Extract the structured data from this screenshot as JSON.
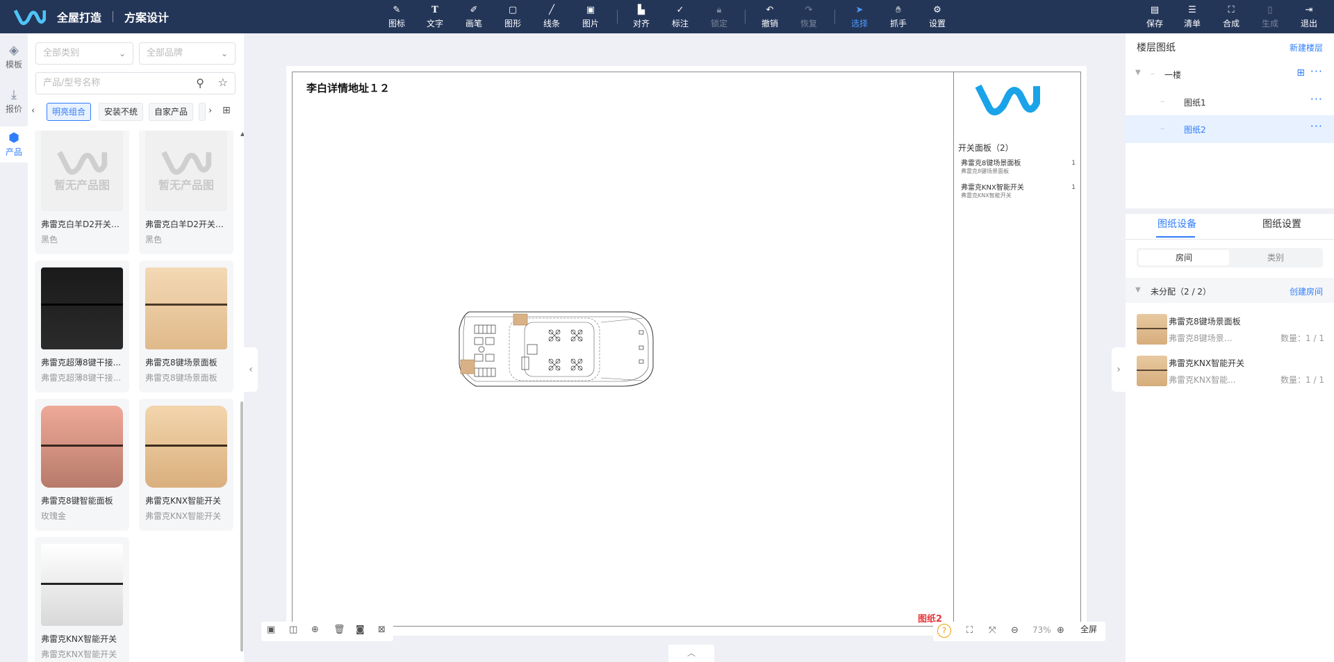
{
  "header": {
    "brand_title": "全屋打造",
    "brand_subtitle": "方案设计"
  },
  "toolbar": {
    "tools": [
      {
        "id": "icon",
        "label": "图标",
        "icon": "shapes-icon"
      },
      {
        "id": "text",
        "label": "文字",
        "icon": "text-icon"
      },
      {
        "id": "pen",
        "label": "画笔",
        "icon": "pen-icon"
      },
      {
        "id": "shape",
        "label": "图形",
        "icon": "rectangle-icon"
      },
      {
        "id": "line",
        "label": "线条",
        "icon": "line-icon"
      },
      {
        "id": "image",
        "label": "图片",
        "icon": "image-icon"
      },
      {
        "id": "align",
        "label": "对齐",
        "icon": "align-icon"
      },
      {
        "id": "mark",
        "label": "标注",
        "icon": "pin-icon"
      },
      {
        "id": "lock",
        "label": "锁定",
        "icon": "lock-icon"
      },
      {
        "id": "undo",
        "label": "撤销",
        "icon": "undo-icon"
      },
      {
        "id": "redo",
        "label": "恢复",
        "icon": "redo-icon"
      },
      {
        "id": "select",
        "label": "选择",
        "icon": "cursor-icon"
      },
      {
        "id": "grab",
        "label": "抓手",
        "icon": "hand-icon"
      },
      {
        "id": "settings",
        "label": "设置",
        "icon": "gear-icon"
      }
    ],
    "actions": [
      {
        "id": "save",
        "label": "保存"
      },
      {
        "id": "list",
        "label": "清单"
      },
      {
        "id": "compose",
        "label": "合成"
      },
      {
        "id": "generate",
        "label": "生成"
      },
      {
        "id": "exit",
        "label": "退出"
      }
    ]
  },
  "leftnav": [
    {
      "label": "模板",
      "icon": "layers-icon"
    },
    {
      "label": "报价",
      "icon": "download-icon"
    },
    {
      "label": "产品",
      "icon": "cube-icon"
    }
  ],
  "filters": {
    "category_placeholder": "全部类别",
    "brand_placeholder": "全部品牌",
    "search_placeholder": "产品/型号名称"
  },
  "tags": [
    "明亮组合",
    "安装不统",
    "自家产品"
  ],
  "products": [
    {
      "name": "弗雷克白羊D2开关分...",
      "sub": "黑色",
      "style": "none",
      "noimg_text": "暂无产品图"
    },
    {
      "name": "弗雷克白羊D2开关分...",
      "sub": "黑色",
      "style": "none",
      "noimg_text": "暂无产品图"
    },
    {
      "name": "弗雷克超薄8键干接...",
      "sub": "弗雷克超薄8键干接...",
      "style": "black"
    },
    {
      "name": "弗雷克8键场景面板",
      "sub": "弗雷克8键场景面板",
      "style": "gold"
    },
    {
      "name": "弗雷克8键智能面板",
      "sub": "玫瑰金",
      "style": "rose"
    },
    {
      "name": "弗雷克KNX智能开关",
      "sub": "弗雷克KNX智能开关",
      "style": "gold"
    },
    {
      "name": "弗雷克KNX智能开关",
      "sub": "弗雷克KNX智能开关",
      "style": "silver"
    }
  ],
  "sheet": {
    "title": "李白详情地址１２",
    "summary_header": "开关面板（2）",
    "items": [
      {
        "name": "弗雷克8键场景面板",
        "sub": "弗雷克8键场景面板",
        "qty": "1"
      },
      {
        "name": "弗雷克KNX智能开关",
        "sub": "弗雷克KNX智能开关",
        "qty": "1"
      }
    ],
    "label": "图纸2"
  },
  "zoom": {
    "level": "73%",
    "fullscreen": "全屏"
  },
  "right": {
    "title": "楼层图纸",
    "new_floor": "新建楼层",
    "floors": [
      {
        "label": "一楼",
        "level": 0
      },
      {
        "label": "图纸1",
        "level": 1
      },
      {
        "label": "图纸2",
        "level": 1,
        "active": true
      }
    ],
    "tabs": [
      "图纸设备",
      "图纸设置"
    ],
    "segments": [
      "房间",
      "类别"
    ],
    "unassigned": "未分配（2 / 2）",
    "create_room": "创建房间",
    "devices": [
      {
        "name": "弗雷克8键场景面板",
        "sub": "弗雷克8键场景面...",
        "qty": "数量：1 / 1"
      },
      {
        "name": "弗雷克KNX智能开关",
        "sub": "弗雷克KNX智能...",
        "qty": "数量：1 / 1"
      }
    ]
  },
  "colors": {
    "topbar": "#243658",
    "accent": "#2f7dfa",
    "danger": "#e5383b"
  }
}
